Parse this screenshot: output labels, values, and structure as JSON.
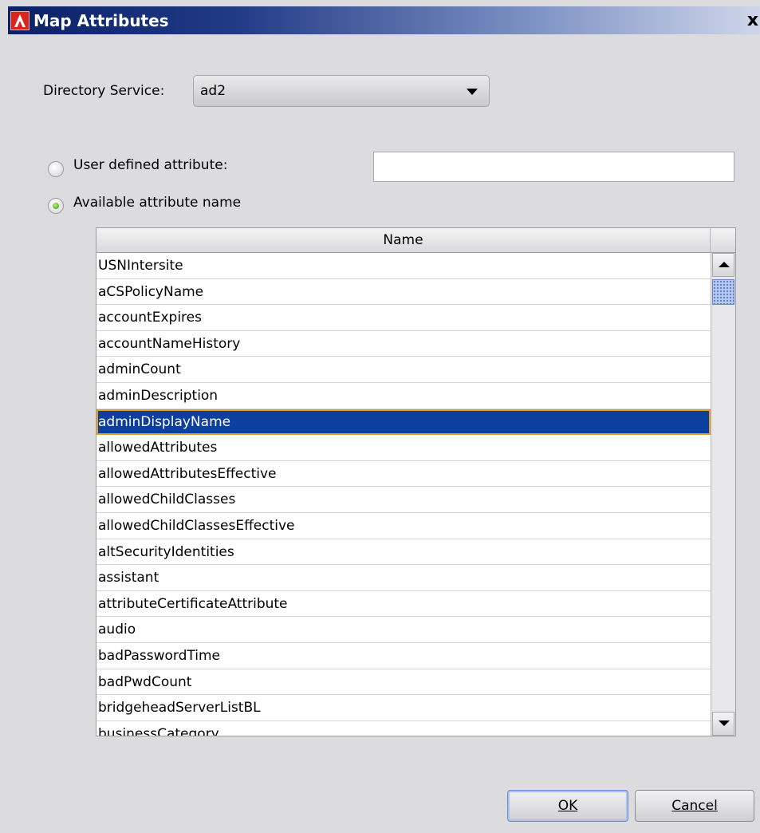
{
  "dialog": {
    "title": "Map Attributes",
    "close_label": "x"
  },
  "directory_service": {
    "label": "Directory Service:",
    "value": "ad2"
  },
  "options": {
    "user_defined_label": "User defined attribute:",
    "user_defined_value": "",
    "available_label": "Available attribute name",
    "selected": "available"
  },
  "table": {
    "header": "Name",
    "rows": [
      "USNIntersite",
      "aCSPolicyName",
      "accountExpires",
      "accountNameHistory",
      "adminCount",
      "adminDescription",
      "adminDisplayName",
      "allowedAttributes",
      "allowedAttributesEffective",
      "allowedChildClasses",
      "allowedChildClassesEffective",
      "altSecurityIdentities",
      "assistant",
      "attributeCertificateAttribute",
      "audio",
      "badPasswordTime",
      "badPwdCount",
      "bridgeheadServerListBL",
      "businessCategory"
    ],
    "selected_row": "adminDisplayName"
  },
  "buttons": {
    "ok_label": "OK",
    "cancel_label": "Cancel"
  },
  "colors": {
    "title_bar": "#0a2168",
    "selection": "#0c3fa0",
    "selection_outline": "#e3a020"
  }
}
